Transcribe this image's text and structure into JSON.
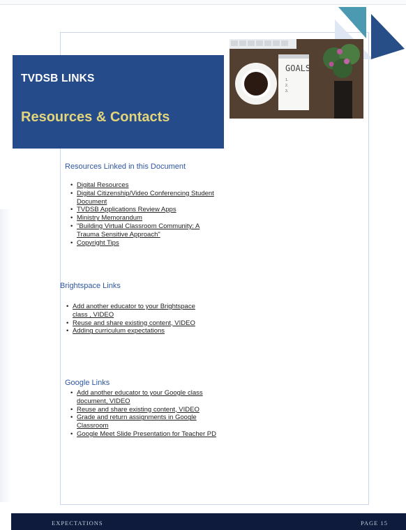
{
  "banner": {
    "title": "TVDSB LINKS",
    "subtitle": "Resources & Contacts"
  },
  "photo": {
    "notepad_text": "GOALS",
    "list_markers": [
      "1.",
      "2.",
      "3."
    ]
  },
  "sections": {
    "resources": {
      "title": "Resources Linked in this Document",
      "items": [
        "Digital Resources",
        "Digital Citizenship/Video Conferencing Student Document",
        "TVDSB Applications Review Apps",
        "Ministry Memorandum",
        "\"Building Virtual Classroom Community: A Trauma Sensitive Approach\"",
        "Copyright Tips"
      ]
    },
    "brightspace": {
      "title": "Brightspace Links",
      "items": [
        "Add another educator to your Brightspace class , VIDEO",
        "Reuse and share existing content, VIDEO",
        "Adding curriculum expectations"
      ]
    },
    "google": {
      "title": "Google Links",
      "items": [
        "Add another educator to your Google class document, VIDEO",
        "Reuse and share existing content, VIDEO",
        "Grade and return assignments in Google Classroom",
        "Google Meet Slide Presentation for Teacher PD"
      ]
    }
  },
  "footer": {
    "left": "EXPECTATIONS",
    "right": "PAGE 15"
  },
  "colors": {
    "banner": "#264b8a",
    "subtitle": "#e3d57a",
    "section_title": "#2f56a3",
    "footer": "#0e1b3d",
    "deco_teal": "#4c9ab2",
    "deco_navy": "#274e86"
  }
}
